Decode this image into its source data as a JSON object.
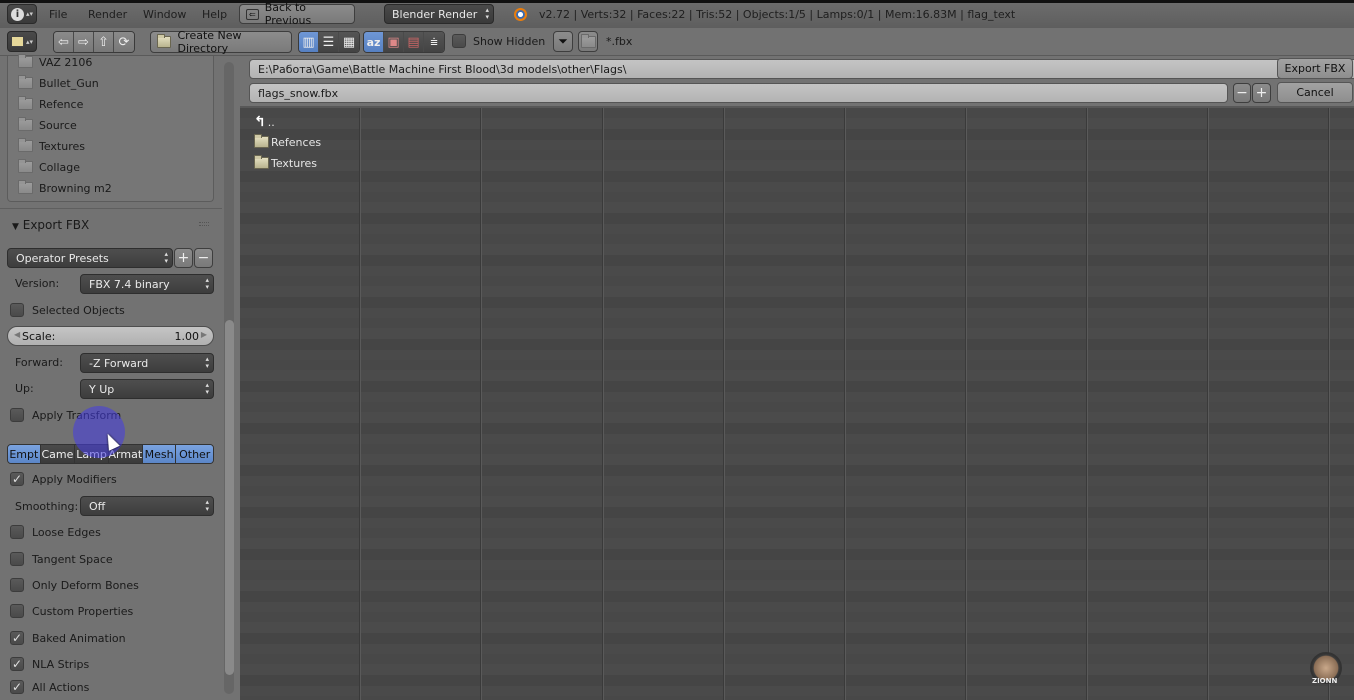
{
  "topbar": {
    "info_icon": "info-icon",
    "menu": [
      "File",
      "Render",
      "Window",
      "Help"
    ],
    "back_button": "Back to Previous",
    "render_engine": "Blender Render",
    "status": "v2.72 | Verts:32 | Faces:22 | Tris:52 | Objects:1/5 | Lamps:0/1 | Mem:16.83M | flag_text"
  },
  "toolbar": {
    "create_dir": "Create New Directory",
    "show_hidden": "Show Hidden",
    "filter_pattern": "*.fbx",
    "nav_icons": [
      "arrow-left-icon",
      "arrow-right-icon",
      "parent-dir-icon",
      "refresh-icon"
    ],
    "display_modes": [
      "short-list-icon",
      "long-list-icon",
      "thumbnails-icon"
    ],
    "sort_modes": [
      "sort-alpha-icon",
      "sort-extension-icon",
      "sort-time-icon",
      "sort-size-icon"
    ]
  },
  "bookmarks": [
    "VAZ 2106",
    "Bullet_Gun",
    "Refence",
    "Source",
    "Textures",
    "Collage",
    "Browning m2"
  ],
  "export_panel": {
    "title": "Export FBX",
    "operator_presets": "Operator Presets",
    "version_label": "Version:",
    "version_value": "FBX 7.4 binary",
    "selected_objects": {
      "label": "Selected Objects",
      "checked": false
    },
    "scale_label": "Scale:",
    "scale_value": "1.00",
    "forward_label": "Forward:",
    "forward_value": "-Z Forward",
    "up_label": "Up:",
    "up_value": "Y Up",
    "apply_transform": {
      "label": "Apply Transform",
      "checked": false
    },
    "object_types": [
      {
        "label": "Empt",
        "on": true
      },
      {
        "label": "Came",
        "on": false
      },
      {
        "label": "Lamp",
        "on": false
      },
      {
        "label": "Armat",
        "on": false
      },
      {
        "label": "Mesh",
        "on": true
      },
      {
        "label": "Other",
        "on": true
      }
    ],
    "apply_modifiers": {
      "label": "Apply Modifiers",
      "checked": true
    },
    "smoothing_label": "Smoothing:",
    "smoothing_value": "Off",
    "options": [
      {
        "label": "Loose Edges",
        "checked": false
      },
      {
        "label": "Tangent Space",
        "checked": false
      },
      {
        "label": "Only Deform Bones",
        "checked": false
      },
      {
        "label": "Custom Properties",
        "checked": false
      },
      {
        "label": "Baked Animation",
        "checked": true
      },
      {
        "label": "NLA Strips",
        "checked": true
      },
      {
        "label": "All Actions",
        "checked": true
      }
    ]
  },
  "file_browser": {
    "path": "E:\\Работа\\Game\\Battle Machine First Blood\\3d models\\other\\Flags\\",
    "filename": "flags_snow.fbx",
    "export_button": "Export FBX",
    "cancel_button": "Cancel",
    "parent_entry": "..",
    "entries": [
      "Refences",
      "Textures"
    ]
  },
  "watermark": "ZIONN",
  "colors": {
    "accent_blue": "#5b86c8",
    "cursor_highlight": "#4638e6"
  }
}
